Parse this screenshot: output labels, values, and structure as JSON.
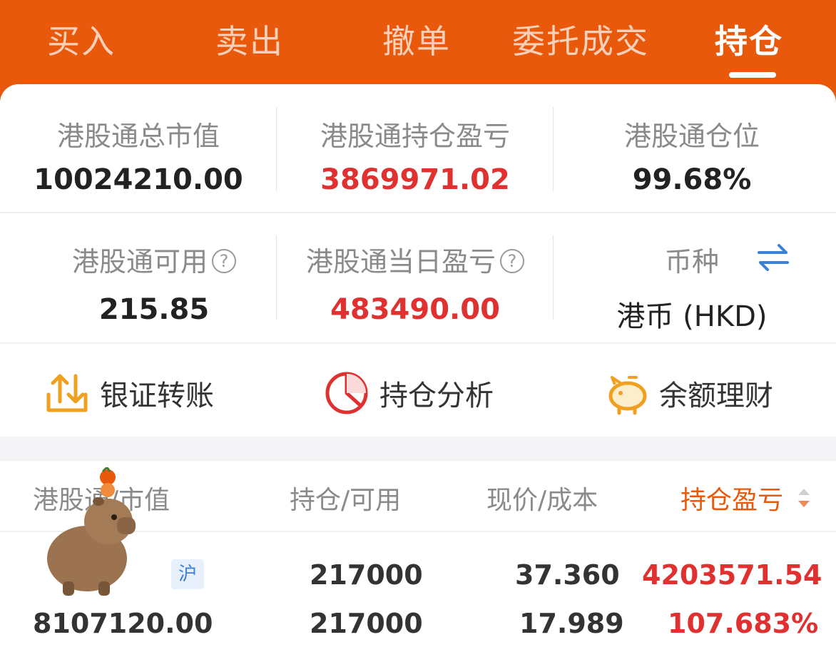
{
  "tabs": [
    {
      "label": "买入"
    },
    {
      "label": "卖出"
    },
    {
      "label": "撤单"
    },
    {
      "label": "委托成交"
    },
    {
      "label": "持仓"
    }
  ],
  "summary": {
    "market_value": {
      "label": "港股通总市值",
      "value": "10024210.00"
    },
    "position_pnl": {
      "label": "港股通持仓盈亏",
      "value": "3869971.02"
    },
    "position_ratio": {
      "label": "港股通仓位",
      "value": "99.68%"
    },
    "available": {
      "label": "港股通可用",
      "value": "215.85"
    },
    "daily_pnl": {
      "label": "港股通当日盈亏",
      "value": "483490.00"
    },
    "currency": {
      "label": "币种",
      "value": "港币 (HKD)"
    }
  },
  "help_glyph": "?",
  "actions": [
    {
      "label": "银证转账",
      "icon": "transfer-icon"
    },
    {
      "label": "持仓分析",
      "icon": "pie-chart-icon"
    },
    {
      "label": "余额理财",
      "icon": "piggy-bank-icon"
    }
  ],
  "table": {
    "headers": {
      "name": "港股通/市值",
      "position": "持仓/可用",
      "price": "现价/成本",
      "pnl": "持仓盈亏"
    },
    "rows": [
      {
        "name": "",
        "market_tag": "沪",
        "market_value": "8107120.00",
        "position": "217000",
        "available": "217000",
        "price": "37.360",
        "cost": "17.989",
        "pnl": "4203571.54",
        "pnl_pct": "107.683%"
      }
    ]
  },
  "colors": {
    "brand_orange": "#e8590c",
    "profit_red": "#e03131",
    "label_gray": "#8a8a8a",
    "link_blue": "#3b82d6"
  }
}
